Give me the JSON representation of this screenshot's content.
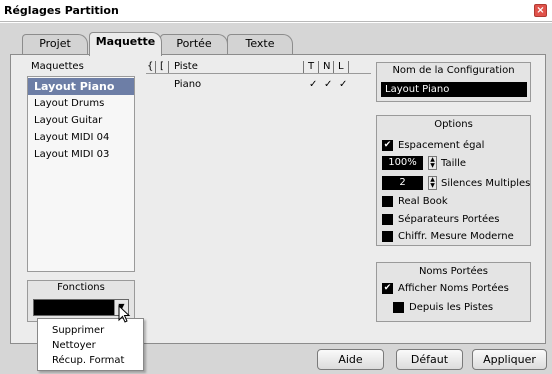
{
  "window": {
    "title": "Réglages Partition",
    "close_glyph": "×"
  },
  "tabs": [
    {
      "label": "Projet",
      "active": false
    },
    {
      "label": "Maquette",
      "active": true
    },
    {
      "label": "Portée",
      "active": false
    },
    {
      "label": "Texte",
      "active": false
    }
  ],
  "layouts": {
    "header": "Maquettes",
    "items": [
      "Layout Piano",
      "Layout Drums",
      "Layout Guitar",
      "Layout MIDI 04",
      "Layout MIDI 03"
    ],
    "selected": "Layout Piano"
  },
  "functions": {
    "label": "Fonctions",
    "menu_items": [
      "Supprimer",
      "Nettoyer",
      "Récup. Format"
    ]
  },
  "track_table": {
    "headers": {
      "brace": "{",
      "bracket": "[",
      "track": "Piste",
      "t": "T",
      "n": "N",
      "l": "L"
    },
    "rows": [
      {
        "track": "Piano",
        "t": "✓",
        "n": "✓",
        "l": "✓"
      }
    ]
  },
  "config": {
    "title": "Nom de la Configuration",
    "value": "Layout Piano"
  },
  "options": {
    "title": "Options",
    "equal_spacing": {
      "label": "Espacement égal",
      "checked": true
    },
    "size": {
      "value": "100%",
      "label": "Taille"
    },
    "multi_rests": {
      "value": "2",
      "label": "Silences Multiples"
    },
    "real_book": {
      "label": "Real Book",
      "checked": false
    },
    "staff_separators": {
      "label": "Séparateurs Portées",
      "checked": false
    },
    "modern_time_sig": {
      "label": "Chiffr. Mesure Moderne",
      "checked": false
    }
  },
  "staff_names": {
    "title": "Noms Portées",
    "show": {
      "label": "Afficher Noms Portées",
      "checked": true
    },
    "from_tracks": {
      "label": "Depuis les Pistes",
      "checked": false
    }
  },
  "buttons": {
    "help": "Aide",
    "default": "Défaut",
    "apply": "Appliquer"
  },
  "icons": {
    "checkmark": "✔",
    "close": "close-icon",
    "spin_up": "▲",
    "spin_down": "▼",
    "dropdown": "▼"
  },
  "colors": {
    "selection": "#6d7ea6",
    "panel": "#ececec",
    "close": "#e0524a"
  }
}
